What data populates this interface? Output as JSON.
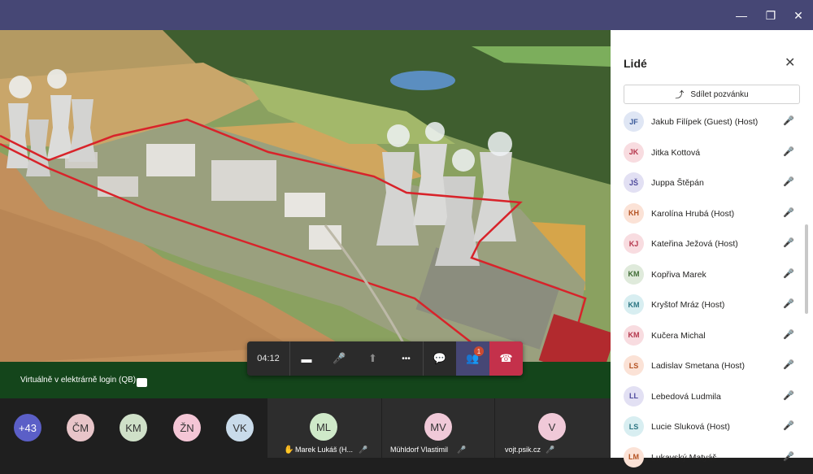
{
  "window": {
    "minimize_icon": "minimize-icon",
    "restore_icon": "restore-icon",
    "close_icon": "close-icon",
    "minimize_glyph": "—",
    "restore_glyph": "❐",
    "close_glyph": "✕"
  },
  "stage": {
    "presenter_label": "Virtuálně v elektrárně login (QB)"
  },
  "callbar": {
    "timer": "04:12",
    "camera_glyph": "▬",
    "mic_glyph": "🎤",
    "share_glyph": "⬆",
    "more_glyph": "•••",
    "chat_glyph": "💬",
    "people_glyph": "👥",
    "people_badge": "1",
    "hangup_glyph": "☎"
  },
  "strip": {
    "overflow_count": "+43",
    "small_avatars": [
      {
        "initials": "ČM",
        "color": "#e8c5c9"
      },
      {
        "initials": "KM",
        "color": "#cfe0c8"
      },
      {
        "initials": "ŽN",
        "color": "#f4c6d6"
      },
      {
        "initials": "VK",
        "color": "#c9dbea"
      }
    ],
    "tiles": [
      {
        "initials": "ML",
        "name": "Marek Lukáš (H...",
        "color": "#cfe9c9"
      },
      {
        "initials": "MV",
        "name": "Mühldorf Vlastimil",
        "color": "#f0c9d8"
      },
      {
        "initials": "V",
        "name": "vojt.psik.cz",
        "color": "#f0c9d8"
      }
    ],
    "hand_glyph": "✋",
    "mic_off_glyph": "🎤"
  },
  "panel": {
    "title": "Lidé",
    "close_glyph": "✕",
    "invite_label": "Sdílet pozvánku",
    "invite_glyph": "⤴",
    "mic_off_glyph": "🎤",
    "participants": [
      {
        "initials": "JF",
        "name": "Jakub Filípek (Guest) (Host)",
        "bg": "#dfe6f4",
        "fg": "#3b5b9a"
      },
      {
        "initials": "JK",
        "name": "Jitka Kottová",
        "bg": "#f8dce0",
        "fg": "#b4364c"
      },
      {
        "initials": "JŠ",
        "name": "Juppa Štěpán",
        "bg": "#e2e0f3",
        "fg": "#4f4a9c"
      },
      {
        "initials": "KH",
        "name": "Karolína Hrubá (Host)",
        "bg": "#fbe2d6",
        "fg": "#b45222"
      },
      {
        "initials": "KJ",
        "name": "Kateřina Ježová (Host)",
        "bg": "#f8dce0",
        "fg": "#b4364c"
      },
      {
        "initials": "KM",
        "name": "Kopřiva Marek",
        "bg": "#dfeadb",
        "fg": "#3f6b34"
      },
      {
        "initials": "KM",
        "name": "Kryštof Mráz (Host)",
        "bg": "#d8eef1",
        "fg": "#2c7582"
      },
      {
        "initials": "KM",
        "name": "Kučera Michal",
        "bg": "#f8dce0",
        "fg": "#b4364c"
      },
      {
        "initials": "LS",
        "name": "Ladislav Smetana (Host)",
        "bg": "#fbe2d6",
        "fg": "#b45222"
      },
      {
        "initials": "LL",
        "name": "Lebedová Ludmila",
        "bg": "#e2e0f3",
        "fg": "#4f4a9c"
      },
      {
        "initials": "LS",
        "name": "Lucie Sluková (Host)",
        "bg": "#d8eef1",
        "fg": "#2c7582"
      },
      {
        "initials": "LM",
        "name": "Lukavský Matyáš",
        "bg": "#fbe2d6",
        "fg": "#b45222"
      }
    ]
  }
}
